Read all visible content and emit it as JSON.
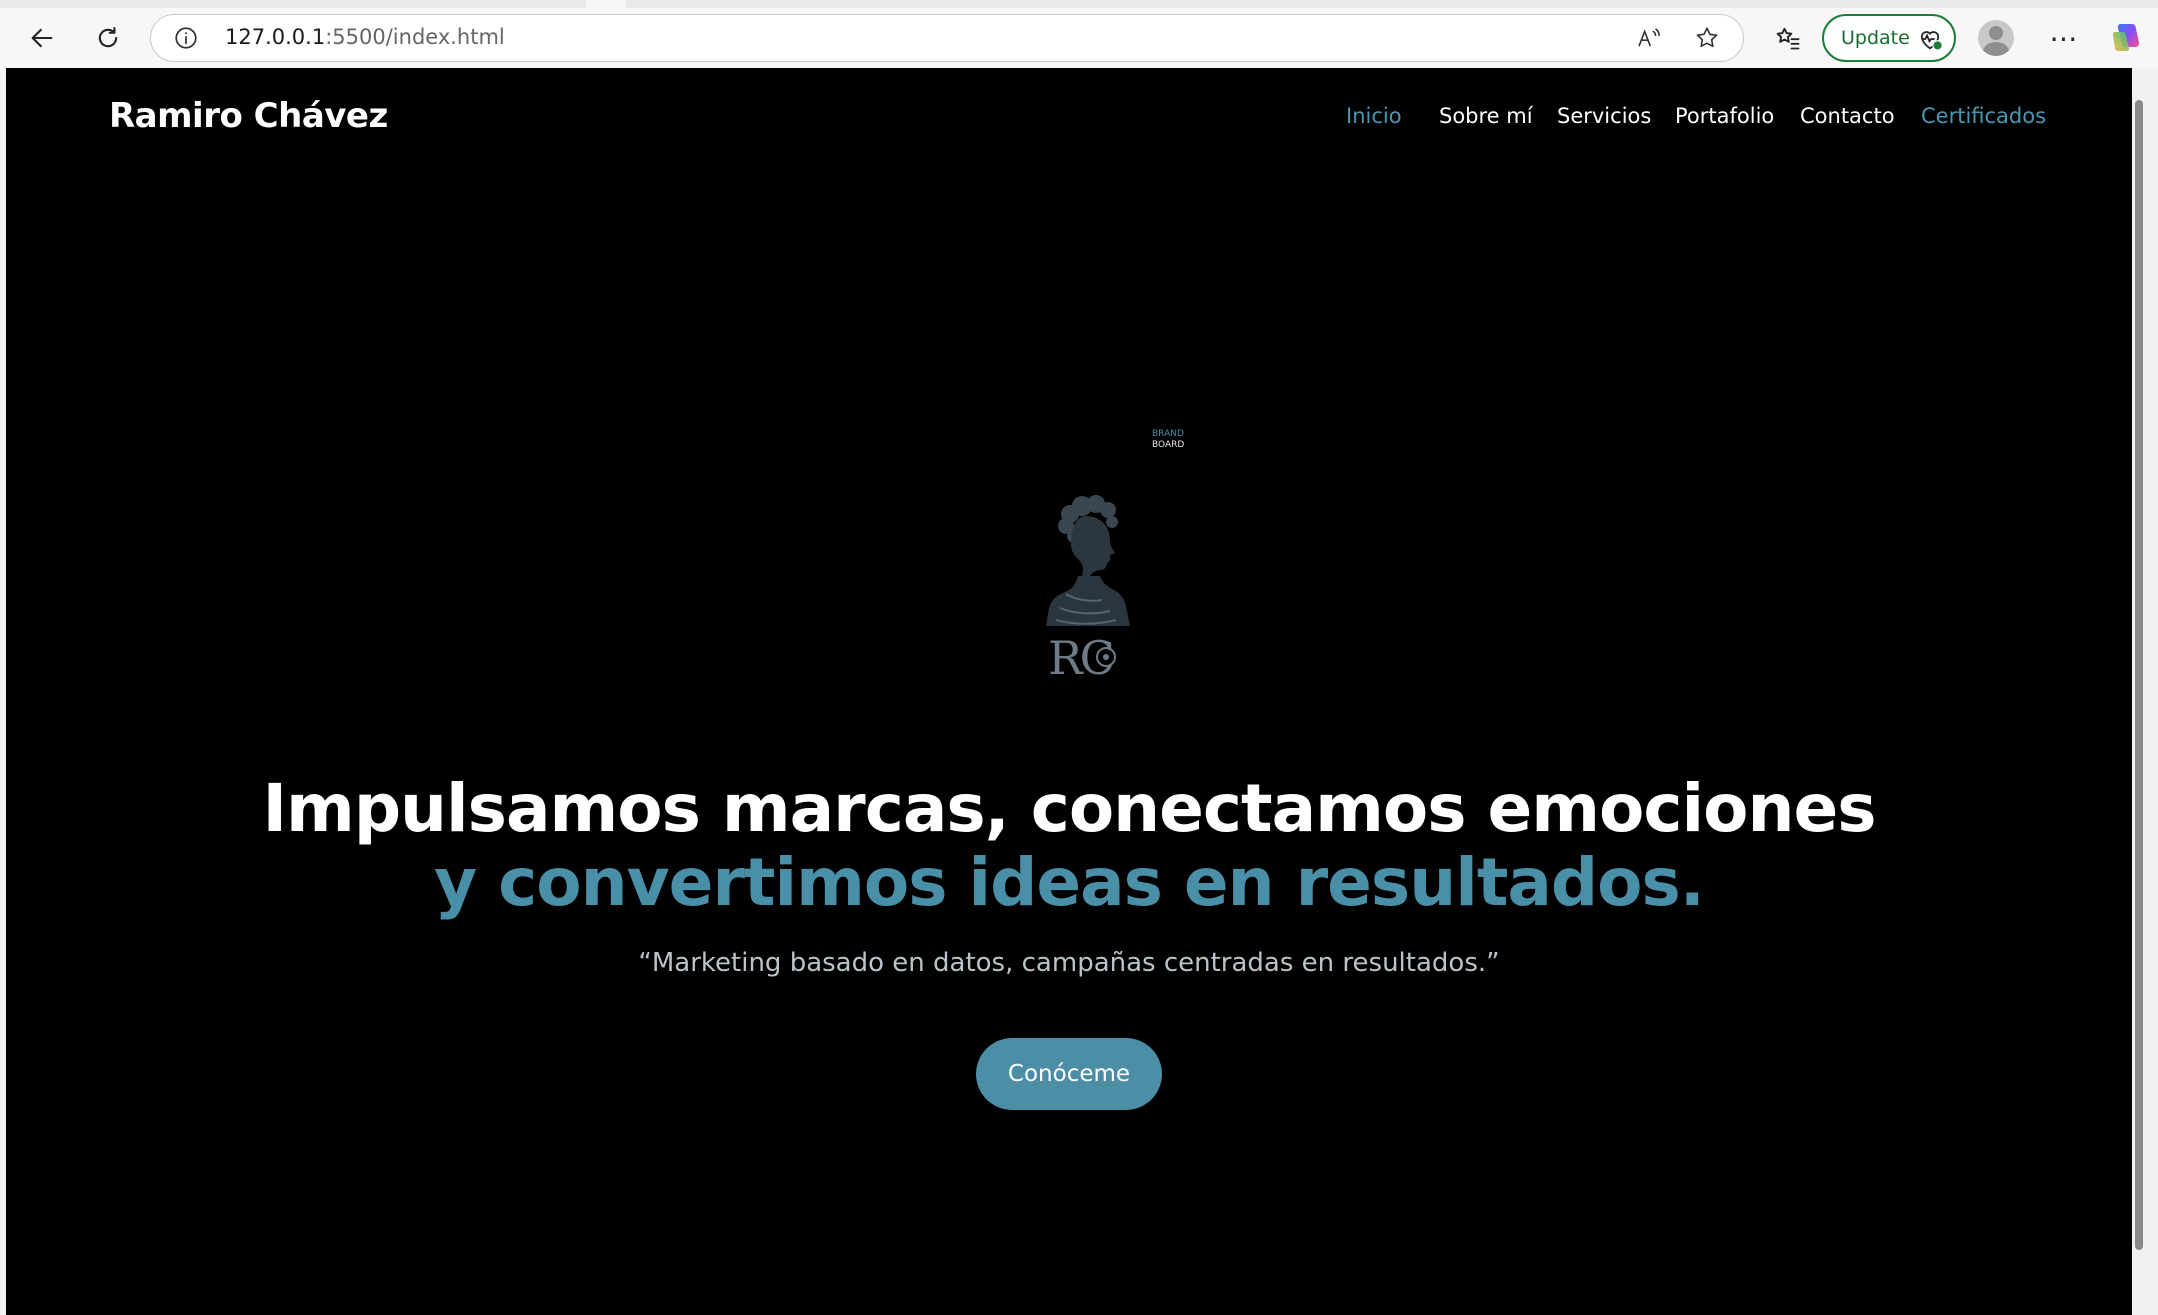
{
  "browser": {
    "url_host": "127.0.0.1",
    "url_rest": ":5500/index.html",
    "update_label": "Update",
    "more_label": "⋯",
    "icons": {
      "back": "back-arrow-icon",
      "reload": "reload-icon",
      "info": "info-icon",
      "read_aloud": "read-aloud-icon",
      "favorite": "star-icon",
      "favorites_list": "favorites-list-icon",
      "profile": "avatar-icon",
      "copilot": "copilot-icon"
    }
  },
  "site": {
    "brand": "Ramiro Chávez",
    "nav": [
      {
        "label": "Inicio",
        "state": "active"
      },
      {
        "label": "Sobre mí",
        "state": "normal"
      },
      {
        "label": "Servicios",
        "state": "normal"
      },
      {
        "label": "Portafolio",
        "state": "normal"
      },
      {
        "label": "Contacto",
        "state": "normal"
      },
      {
        "label": "Certificados",
        "state": "accent"
      }
    ],
    "logo": {
      "monogram": "RC",
      "tag_line1": "BRAND",
      "tag_line2": "BOARD"
    },
    "hero": {
      "title_line1": "Impulsamos marcas, conectamos emociones",
      "title_line2": "y convertimos ideas en resultados.",
      "quote": "“Marketing basado en datos, campañas centradas en resultados.”",
      "cta_label": "Conóceme"
    }
  },
  "colors": {
    "accent": "#4a97b2",
    "page_bg": "#000000",
    "button_bg": "#4b8ea6",
    "update_green": "#1c7d3a"
  }
}
